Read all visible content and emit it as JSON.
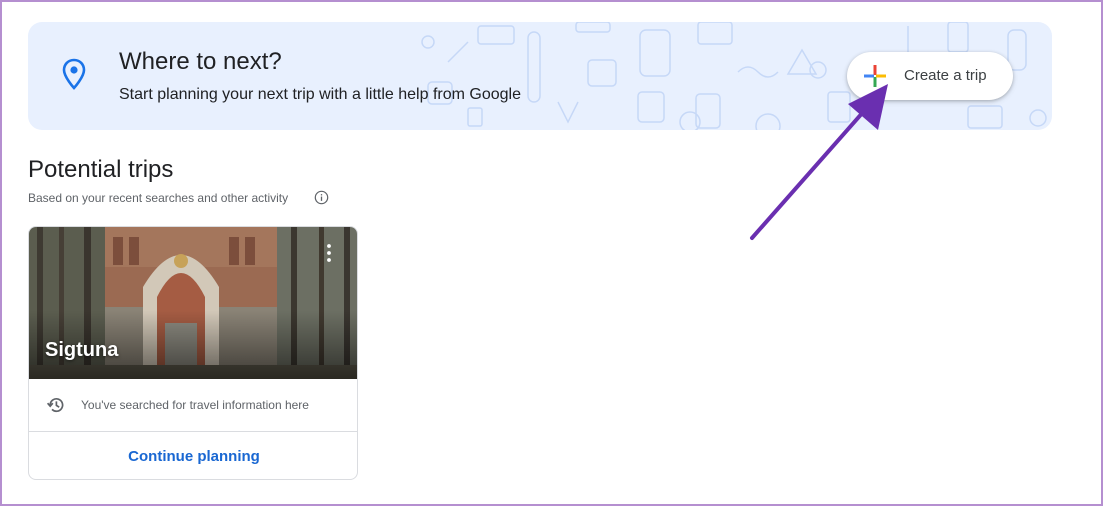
{
  "banner": {
    "title": "Where to next?",
    "subtitle": "Start planning your next trip with a little help from Google",
    "create_button_label": "Create a trip"
  },
  "section": {
    "title": "Potential trips",
    "subtitle": "Based on your recent searches and other activity"
  },
  "trips": [
    {
      "name": "Sigtuna",
      "note": "You've searched for travel information here",
      "action_label": "Continue planning"
    }
  ],
  "colors": {
    "banner_bg": "#e8f0fe",
    "accent_blue": "#1967d2",
    "annotation_arrow": "#6a2fb0"
  },
  "icons": [
    "location-pin-icon",
    "plus-icon",
    "info-icon",
    "more-vert-icon",
    "history-icon"
  ]
}
